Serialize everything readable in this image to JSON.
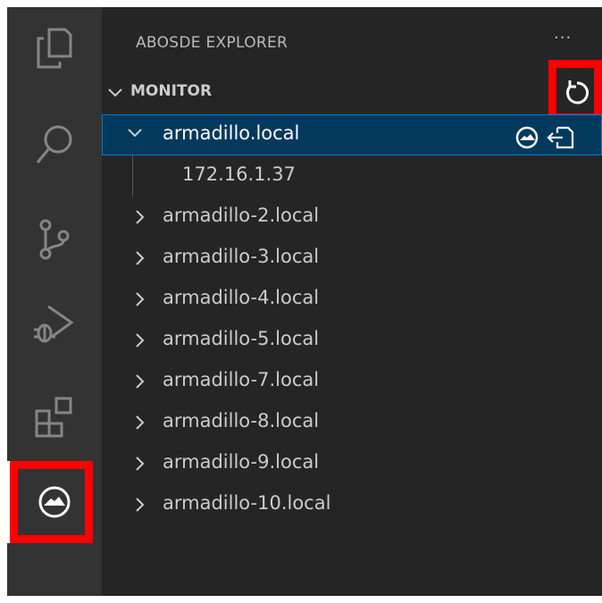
{
  "sidebar": {
    "title": "ABOSDE EXPLORER",
    "more_actions": "···",
    "section": {
      "title": "MONITOR"
    },
    "devices": [
      {
        "label": "armadillo.local",
        "expanded": true,
        "selected": true,
        "children": [
          {
            "label": "172.16.1.37"
          }
        ]
      },
      {
        "label": "armadillo-2.local"
      },
      {
        "label": "armadillo-3.local"
      },
      {
        "label": "armadillo-4.local"
      },
      {
        "label": "armadillo-5.local"
      },
      {
        "label": "armadillo-7.local"
      },
      {
        "label": "armadillo-8.local"
      },
      {
        "label": "armadillo-9.local"
      },
      {
        "label": "armadillo-10.local"
      }
    ]
  },
  "activity_bar": {
    "icons": [
      "files-icon",
      "search-icon",
      "source-control-icon",
      "run-debug-icon",
      "extensions-icon",
      "abosde-icon"
    ],
    "active": "abosde-icon"
  },
  "colors": {
    "activity_bar": "#333333",
    "sidebar": "#252526",
    "selection": "#04395e",
    "selection_border": "#007fd4",
    "highlight": "#ff0000"
  }
}
